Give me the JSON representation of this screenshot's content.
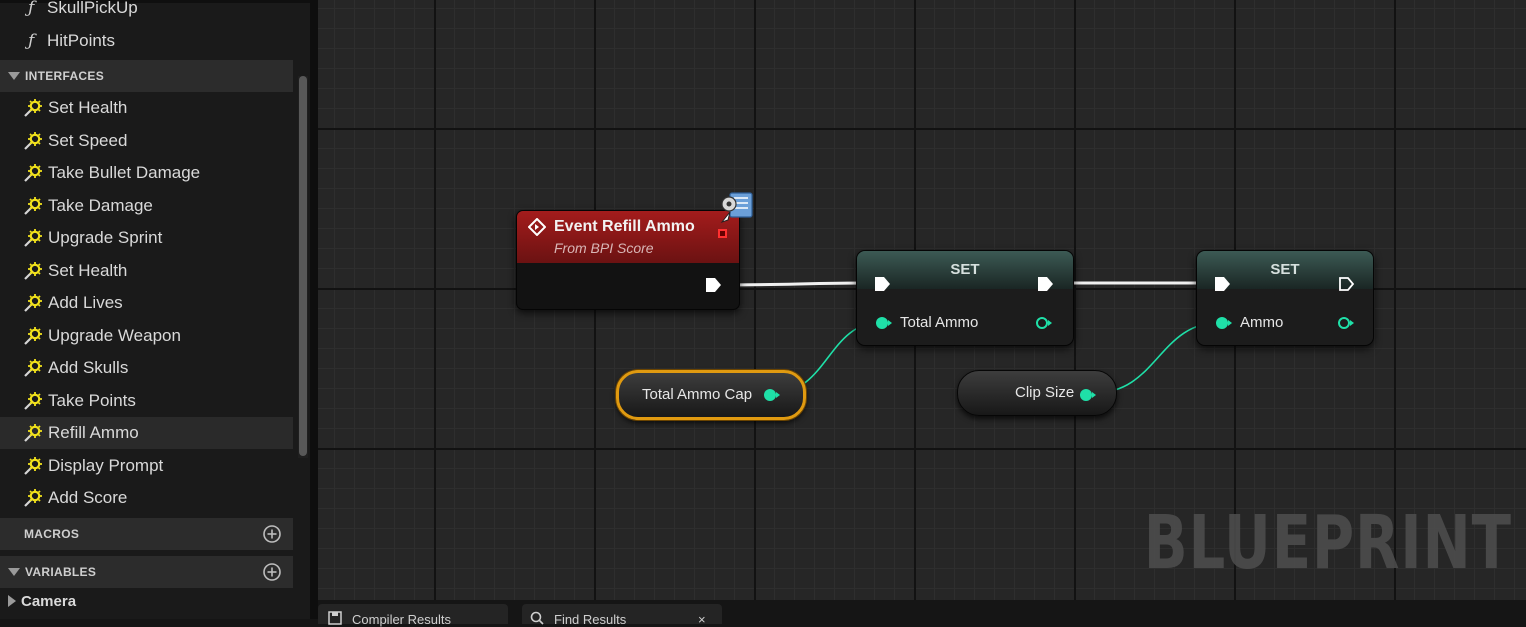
{
  "functions": [
    "SkullPickUp",
    "HitPoints"
  ],
  "sections": {
    "interfaces": "INTERFACES",
    "macros": "MACROS",
    "variables": "VARIABLES"
  },
  "interfaces": [
    "Set Health",
    "Set Speed",
    "Take Bullet Damage",
    "Take Damage",
    "Upgrade Sprint",
    "Set Health",
    "Add Lives",
    "Upgrade Weapon",
    "Add Skulls",
    "Take Points",
    "Refill Ammo",
    "Display Prompt",
    "Add Score"
  ],
  "selected_interface": "Refill Ammo",
  "variables": [
    "Camera"
  ],
  "graph": {
    "event_node": {
      "title": "Event Refill Ammo",
      "subtitle": "From BPI Score"
    },
    "set_node_1": {
      "title": "SET",
      "pin": "Total Ammo"
    },
    "set_node_2": {
      "title": "SET",
      "pin": "Ammo"
    },
    "var_total_ammo_cap": "Total Ammo Cap",
    "var_clip_size": "Clip Size",
    "watermark": "BLUEPRINT"
  },
  "tabs": [
    "Compiler Results",
    "Find Results"
  ],
  "colors": {
    "exec_pin": "#ffffff",
    "int_pin": "#1fe0a8",
    "event_header": "#a41c1c",
    "selected_outline": "#e09a10"
  },
  "icons": {
    "function": "function-icon",
    "interface": "interface-function-icon",
    "add": "plus-circle-icon",
    "event": "event-diamond-icon"
  }
}
